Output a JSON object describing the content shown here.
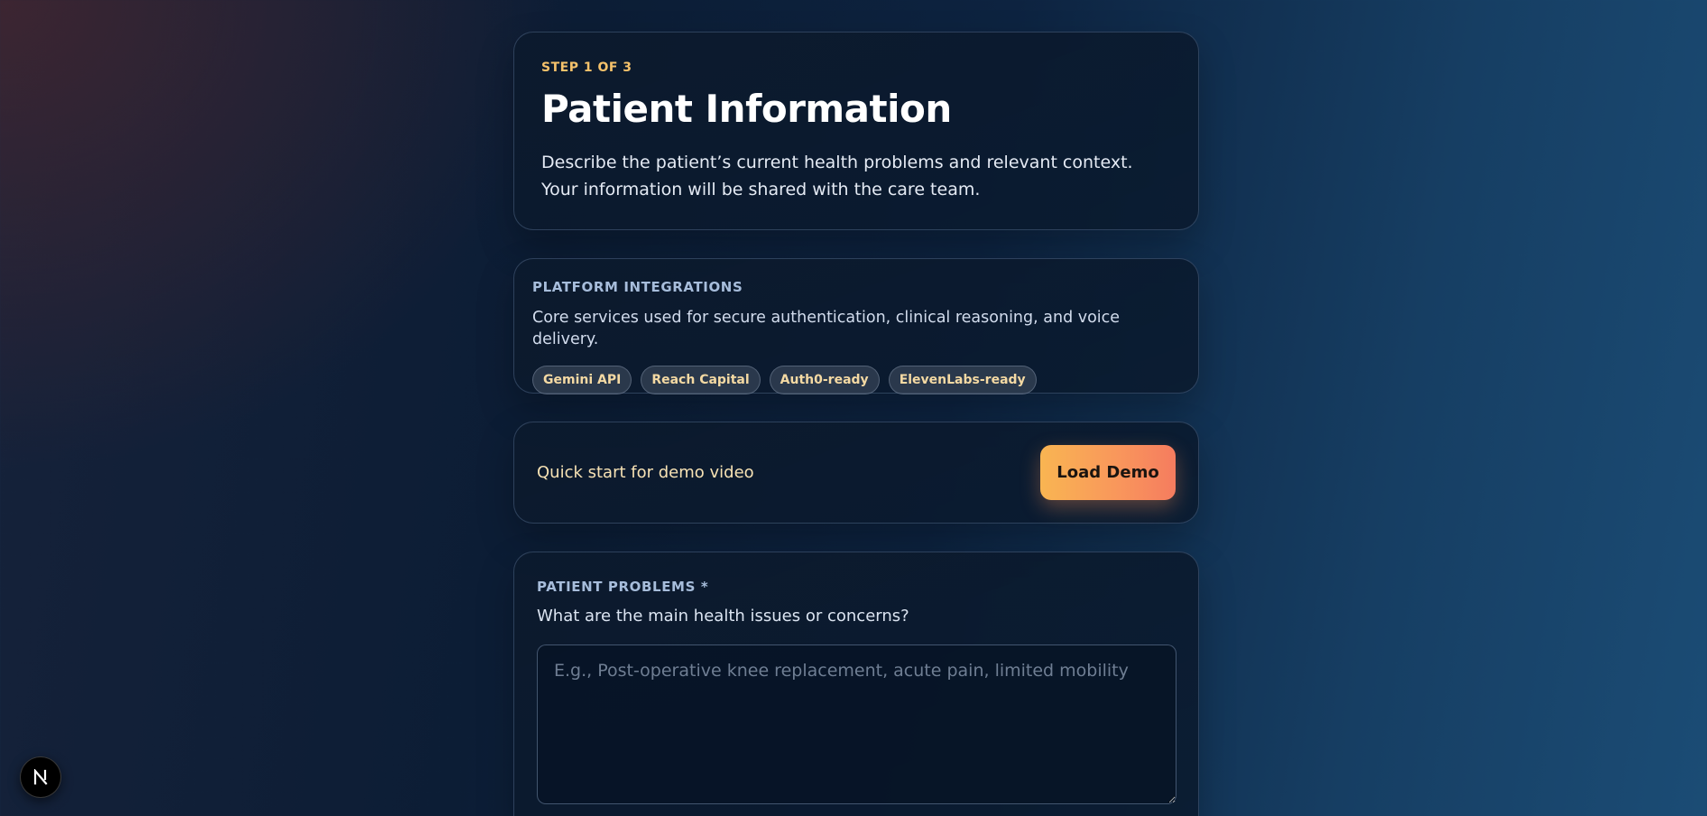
{
  "header": {
    "step": "STEP 1 OF 3",
    "title": "Patient Information",
    "description": "Describe the patient’s current health problems and relevant context. Your information will be shared with the care team."
  },
  "integrations": {
    "heading": "PLATFORM INTEGRATIONS",
    "text": "Core services used for secure authentication, clinical reasoning, and voice delivery.",
    "pills": [
      "Gemini API",
      "Reach Capital",
      "Auth0-ready",
      "ElevenLabs-ready"
    ]
  },
  "demo": {
    "text": "Quick start for demo video",
    "button_label": "Load Demo"
  },
  "problems": {
    "label": "PATIENT PROBLEMS *",
    "hint": "What are the main health issues or concerns?",
    "value": "",
    "placeholder": "E.g., Post-operative knee replacement, acute pain, limited mobility"
  },
  "badge": {
    "icon": "nextjs-icon"
  },
  "colors": {
    "accent": "#f6c26b",
    "button_start": "#f9b552",
    "button_end": "#f57c5f"
  }
}
